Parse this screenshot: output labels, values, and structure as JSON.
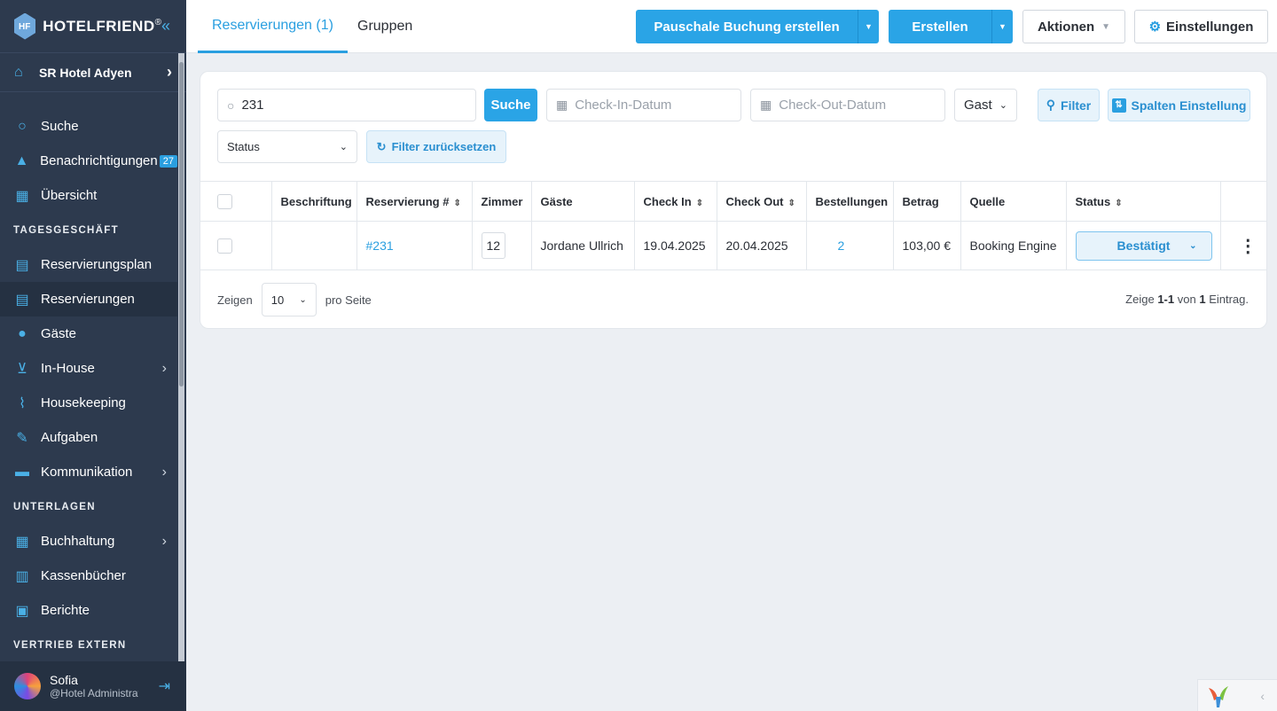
{
  "brand": {
    "name": "HOTELFRIEND",
    "reg": "®"
  },
  "hotel": {
    "name": "SR Hotel Adyen"
  },
  "sidebar": {
    "items": [
      {
        "label": "Suche",
        "icon": "search-icon"
      },
      {
        "label": "Benachrichtigungen",
        "icon": "bell-icon",
        "badge": "27"
      },
      {
        "label": "Übersicht",
        "icon": "dashboard-icon"
      }
    ],
    "section1": "TAGESGESCHÄFT",
    "daily": [
      {
        "label": "Reservierungsplan",
        "icon": "calendar-icon"
      },
      {
        "label": "Reservierungen",
        "icon": "document-icon"
      },
      {
        "label": "Gäste",
        "icon": "person-icon"
      },
      {
        "label": "In-House",
        "icon": "cart-icon"
      },
      {
        "label": "Housekeeping",
        "icon": "broom-icon"
      },
      {
        "label": "Aufgaben",
        "icon": "wrench-icon"
      },
      {
        "label": "Kommunikation",
        "icon": "chat-icon"
      }
    ],
    "section2": "UNTERLAGEN",
    "docs": [
      {
        "label": "Buchhaltung",
        "icon": "ledger-icon"
      },
      {
        "label": "Kassenbücher",
        "icon": "book-icon"
      },
      {
        "label": "Berichte",
        "icon": "clipboard-icon"
      }
    ],
    "section3": "VERTRIEB EXTERN"
  },
  "user": {
    "name": "Sofia",
    "role": "@Hotel Administrator"
  },
  "tabs": [
    "Reservierungen (1)",
    "Gruppen"
  ],
  "toolbar": {
    "package": "Pauschale Buchung erstellen",
    "create": "Erstellen",
    "actions": "Aktionen",
    "settings": "Einstellungen"
  },
  "filters": {
    "search_value": "231",
    "search_btn": "Suche",
    "checkin_ph": "Check-In-Datum",
    "checkout_ph": "Check-Out-Datum",
    "guest_select": "Gast",
    "filter_btn": "Filter",
    "columns_btn": "Spalten Einstellung",
    "status_select": "Status",
    "reset_btn": "Filter zurücksetzen"
  },
  "table": {
    "headers": [
      "Beschriftung",
      "Reservierung #",
      "Zimmer",
      "Gäste",
      "Check In",
      "Check Out",
      "Bestellungen",
      "Betrag",
      "Quelle",
      "Status"
    ],
    "row": {
      "label": "",
      "reservation": "#231",
      "room": "12",
      "guest": "Jordane Ullrich",
      "checkin": "19.04.2025",
      "checkout": "20.04.2025",
      "orders": "2",
      "amount": "103,00 €",
      "source": "Booking Engine",
      "status": "Bestätigt"
    }
  },
  "pagination": {
    "show": "Zeigen",
    "per_page_value": "10",
    "per_page": "pro Seite",
    "summary_pre": "Zeige",
    "range": "1-1",
    "of": "von",
    "total": "1",
    "entry": "Eintrag."
  }
}
